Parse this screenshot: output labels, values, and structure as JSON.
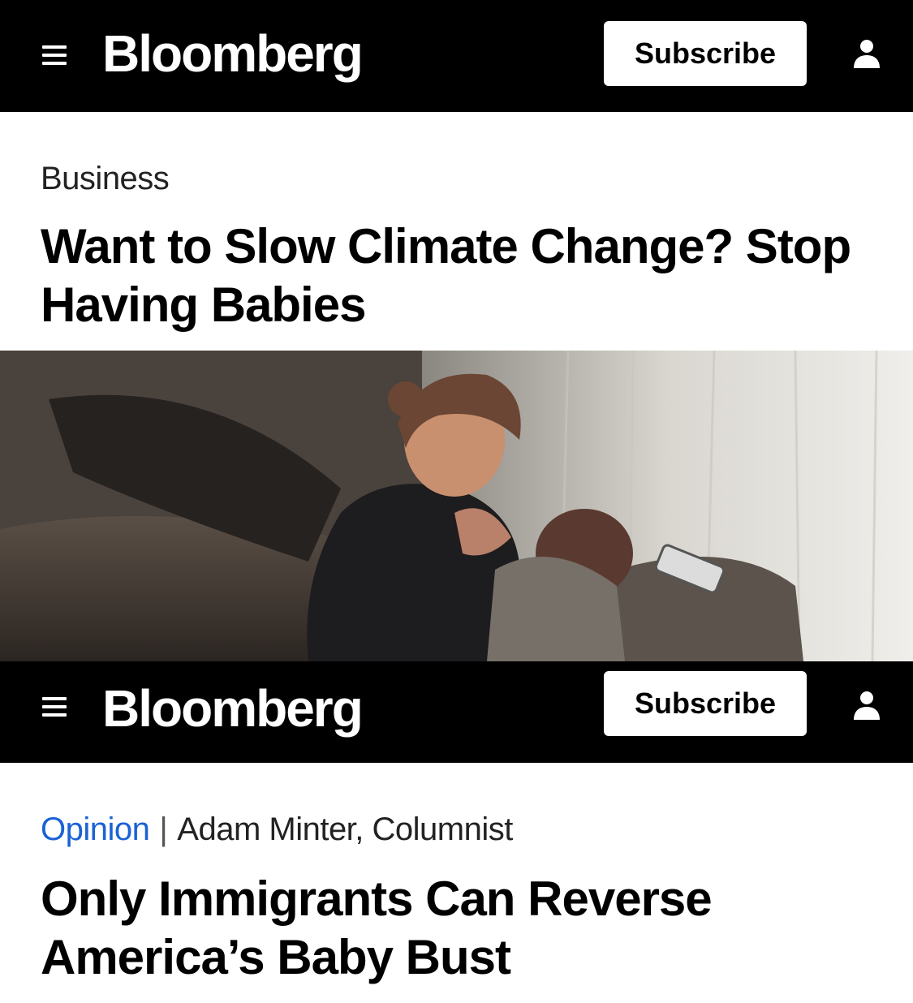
{
  "header1": {
    "brand": "Bloomberg",
    "subscribe_label": "Subscribe"
  },
  "article1": {
    "section": "Business",
    "headline": "Want to Slow Climate Change? Stop Having Babies"
  },
  "header2": {
    "brand": "Bloomberg",
    "subscribe_label": "Subscribe"
  },
  "article2": {
    "section": "Opinion",
    "separator": "|",
    "byline": "Adam Minter, Columnist",
    "headline": "Only Immigrants Can Reverse America’s Baby Bust"
  },
  "icons": {
    "menu": "hamburger-menu-icon",
    "user": "user-account-icon"
  },
  "colors": {
    "bar_background": "#000000",
    "page_background": "#ffffff",
    "opinion_accent": "#1a62d6"
  }
}
